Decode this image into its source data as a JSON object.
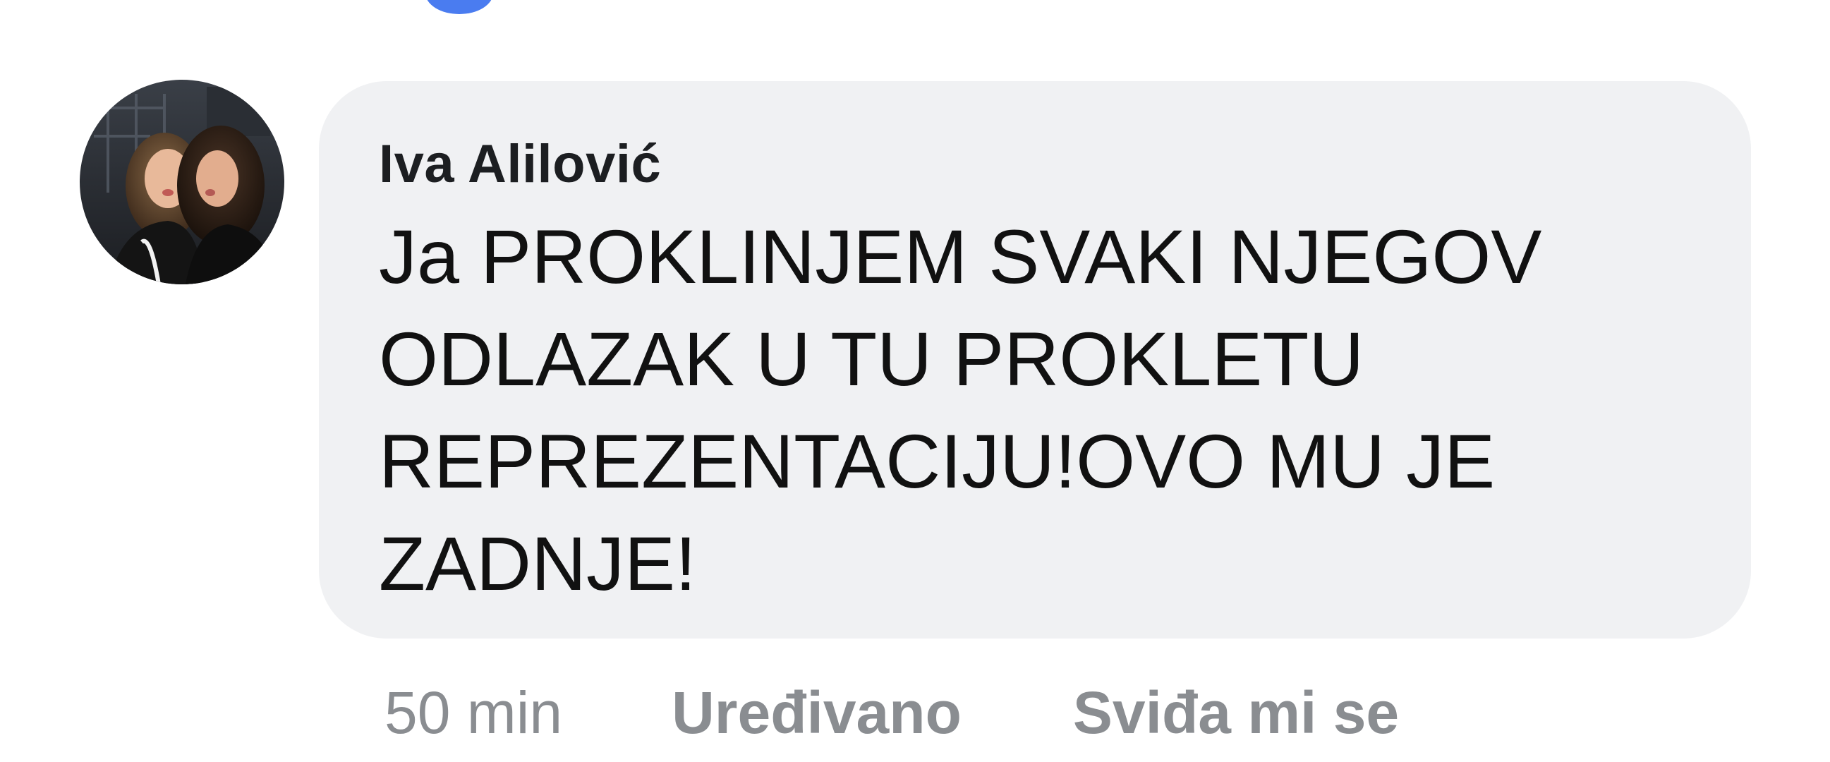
{
  "comment": {
    "author": "Iva Alilović",
    "text": "Ja PROKLINJEM SVAKI NJEGOV ODLAZAK U TU PROKLETU REPREZENTACIJU!OVO MU JE ZADNJE!",
    "time": "50 min",
    "edited_label": "Uređivano",
    "like_label": "Sviđa mi se"
  },
  "colors": {
    "bubble": "#f0f1f3",
    "meta_text": "#8a8d91",
    "author_text": "#1c1e21",
    "reaction_dot": "#4a7cf0"
  }
}
